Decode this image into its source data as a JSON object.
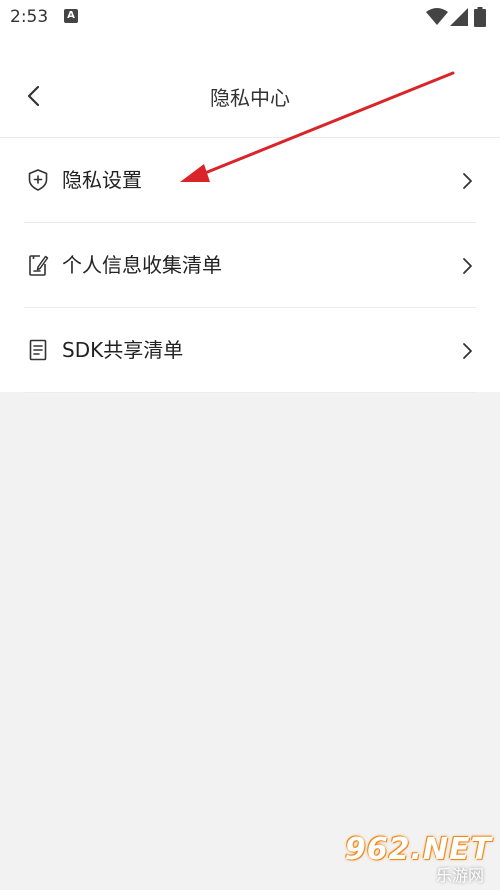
{
  "status_bar": {
    "time": "2:53",
    "notification_icon": "A"
  },
  "header": {
    "title": "隐私中心",
    "back_icon": "chevron-left-icon"
  },
  "menu": {
    "items": [
      {
        "label": "隐私设置",
        "icon": "shield-plus-icon"
      },
      {
        "label": "个人信息收集清单",
        "icon": "clipboard-pen-icon"
      },
      {
        "label": "SDK共享清单",
        "icon": "document-list-icon"
      }
    ]
  },
  "watermark": {
    "main": "962.NET",
    "sub": "乐游网"
  },
  "colors": {
    "background": "#f2f2f2",
    "surface": "#ffffff",
    "annotation_arrow": "#d9252a",
    "watermark_accent": "#f08a1c"
  }
}
